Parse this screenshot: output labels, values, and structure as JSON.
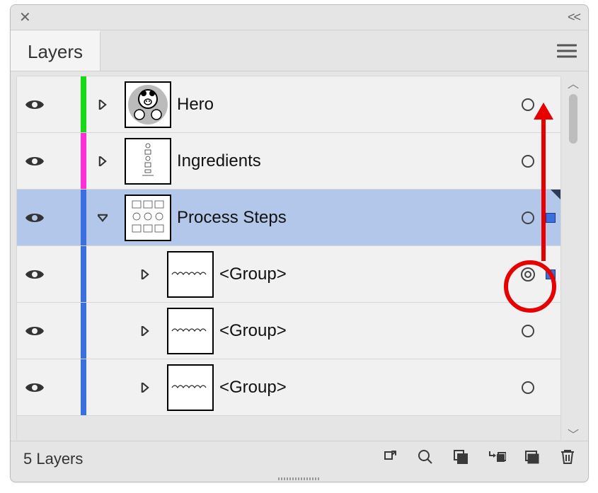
{
  "panel": {
    "title": "Layers"
  },
  "footer": {
    "count": "5 Layers"
  },
  "colors": {
    "layer0": "#18d818",
    "layer1": "#ff2fd8",
    "layer2": "#3b6fe0",
    "sublayer": "#3b6fe0"
  },
  "layers": [
    {
      "name": "Hero",
      "expanded": false,
      "selected": false,
      "hasSelArt": false
    },
    {
      "name": "Ingredients",
      "expanded": false,
      "selected": false,
      "hasSelArt": false
    },
    {
      "name": "Process Steps",
      "expanded": true,
      "selected": true,
      "hasSelArt": true
    },
    {
      "name": "<Group>",
      "expanded": false,
      "selected": false,
      "hasSelArt": true,
      "isChild": true,
      "targeted": true
    },
    {
      "name": "<Group>",
      "expanded": false,
      "selected": false,
      "hasSelArt": false,
      "isChild": true
    },
    {
      "name": "<Group>",
      "expanded": false,
      "selected": false,
      "hasSelArt": false,
      "isChild": true
    }
  ]
}
